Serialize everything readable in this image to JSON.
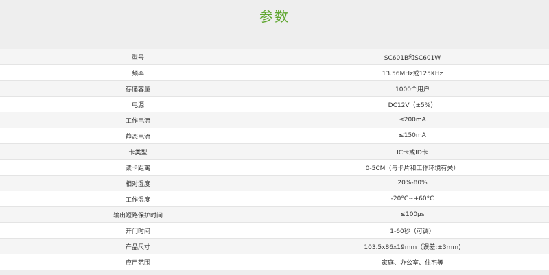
{
  "page": {
    "title": "参数"
  },
  "specs": [
    {
      "label": "型号",
      "value": "SC601B和SC601W"
    },
    {
      "label": "频率",
      "value": "13.56MHz或125KHz"
    },
    {
      "label": "存储容量",
      "value": "1000个用户"
    },
    {
      "label": "电源",
      "value": "DC12V（±5%）"
    },
    {
      "label": "工作电流",
      "value": "≤200mA"
    },
    {
      "label": "静态电流",
      "value": "≤150mA"
    },
    {
      "label": "卡类型",
      "value": "IC卡或ID卡"
    },
    {
      "label": "读卡距离",
      "value": "0-5CM（与卡片和工作环境有关）"
    },
    {
      "label": "相对湿度",
      "value": "20%-80%"
    },
    {
      "label": "工作温度",
      "value": "-20°C~+60°C"
    },
    {
      "label": "输出短路保护时间",
      "value": "≤100μs"
    },
    {
      "label": "开门时间",
      "value": "1-60秒（可调）"
    },
    {
      "label": "产品尺寸",
      "value": "103.5x86x19mm（误差:±3mm)"
    },
    {
      "label": "应用范围",
      "value": "家庭、办公室、住宅等"
    }
  ],
  "colors": {
    "title": "#5fa62f",
    "row_odd": "#f5f5f5",
    "row_even": "#ffffff",
    "background": "#eeeeee"
  }
}
